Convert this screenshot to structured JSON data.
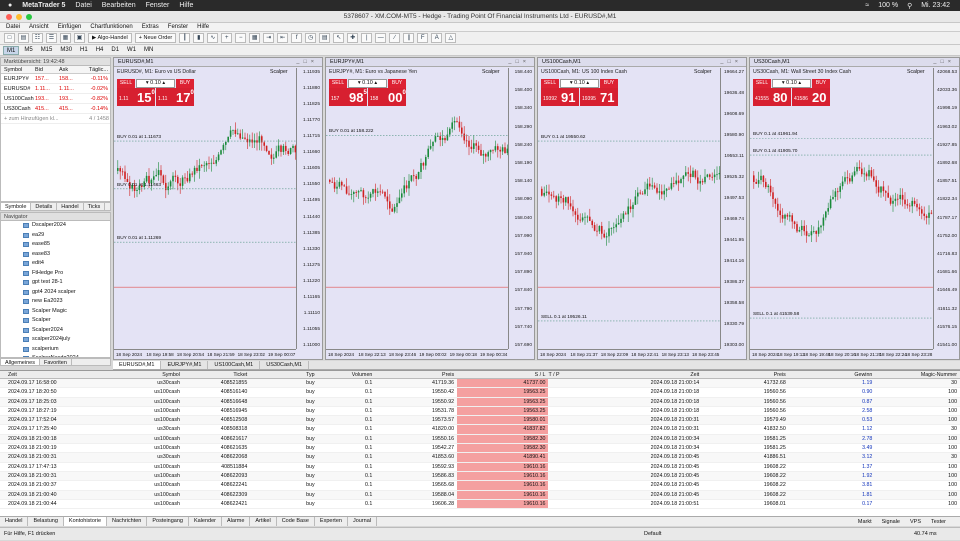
{
  "macbar": {
    "app": "MetaTrader 5",
    "menus": [
      "Datei",
      "Bearbeiten",
      "Fenster",
      "Hilfe"
    ],
    "battery": "100 %",
    "clock": "Mi. 23:42",
    "user": "jm"
  },
  "title": "5378607 - XM.COM-MT5 - Hedge - Trading Point Of Financial Instruments Ltd - EURUSD#,M1",
  "menu": [
    "Datei",
    "Ansicht",
    "Einfügen",
    "Chartfunktionen",
    "Extras",
    "Fenster",
    "Hilfe"
  ],
  "toolbar": {
    "algo": "Algo-Handel",
    "new_order": "Neue Order"
  },
  "timeframes": [
    "M1",
    "M5",
    "M15",
    "M30",
    "H1",
    "H4",
    "D1",
    "W1",
    "MN"
  ],
  "marketwatch": {
    "header": "Marktübersicht: 19:42:48",
    "cols": [
      "Symbol",
      "Bid",
      "Ask",
      "Täglic..."
    ],
    "rows": [
      {
        "s": "EURJPY#",
        "b": "157...",
        "a": "158...",
        "c": "-0.11%"
      },
      {
        "s": "EURUSD#",
        "b": "1.11...",
        "a": "1.11...",
        "c": "-0.02%"
      },
      {
        "s": "US100Cash",
        "b": "193...",
        "a": "193...",
        "c": "-0.82%"
      },
      {
        "s": "US30Cash",
        "b": "415...",
        "a": "415...",
        "c": "-0.14%"
      }
    ],
    "add": "+ zum Hinzufügen kl...",
    "count": "4 / 1458",
    "tabs": [
      "Symbole",
      "Details",
      "Handel",
      "Ticks"
    ]
  },
  "navigator": {
    "header": "Navigator",
    "items": [
      "Dscalper2024",
      "ea29",
      "ease85",
      "ease83",
      "edit4",
      "FtHedge Pro",
      "gpt test 28-1",
      "gpt4 2024 scalper",
      "new Ea2023",
      "Scalper Magic",
      "Scalper",
      "Scalper2024",
      "scalper2024july",
      "scalperium",
      "ScalperNasdq2024"
    ],
    "tabs": [
      "Allgemeines",
      "Favoriten"
    ]
  },
  "charts": [
    {
      "tab": "EURUSD#,M1",
      "sub": "EURUSD#, M1: Euro vs US Dollar",
      "lot": "0.10",
      "bid_pre": "1.11",
      "bid_big": "15",
      "bid_sup": "0",
      "ask_pre": "1.11",
      "ask_big": "17",
      "ask_sup": "0",
      "y": [
        "1.11935",
        "1.11880",
        "1.11825",
        "1.11770",
        "1.11715",
        "1.11660",
        "1.11605",
        "1.11550",
        "1.11495",
        "1.11440",
        "1.11385",
        "1.11330",
        "1.11275",
        "1.11220",
        "1.11165",
        "1.11110",
        "1.11055",
        "1.11000"
      ],
      "x": [
        "18 Sep 2024",
        "18 Sep 19:58",
        "18 Sep 20:54",
        "18 Sep 21:59",
        "18 Sep 23:02",
        "19 Sep 00:07"
      ],
      "orders": [
        {
          "t": "BUY 0.01 at 1.11673",
          "y": 0.26
        },
        {
          "t": "BUY 0.01 at 1.11463",
          "y": 0.43
        },
        {
          "t": "BUY 0.01 at 1.11269",
          "y": 0.62
        }
      ],
      "seed": 3
    },
    {
      "tab": "EURJPY#,M1",
      "sub": "EURJPY#, M1: Euro vs Japanese Yen",
      "lot": "0.10",
      "bid_pre": "157",
      "bid_big": "98",
      "bid_sup": "5",
      "ask_pre": "158",
      "ask_big": "00",
      "ask_sup": "0",
      "y": [
        "158.440",
        "158.400",
        "158.340",
        "158.290",
        "158.240",
        "158.190",
        "158.140",
        "158.090",
        "158.040",
        "157.990",
        "157.940",
        "157.890",
        "157.840",
        "157.790",
        "157.740",
        "157.690"
      ],
      "x": [
        "18 Sep 2024",
        "18 Sep 22:13",
        "18 Sep 23:46",
        "19 Sep 00:02",
        "19 Sep 00:18",
        "19 Sep 00:34"
      ],
      "orders": [
        {
          "t": "BUY 0.01 at 158.222",
          "y": 0.24
        }
      ],
      "seed": 7
    },
    {
      "tab": "US100Cash,M1",
      "sub": "US100Cash, M1: US 100 Index Cash",
      "lot": "0.10",
      "bid_pre": "19392",
      "bid_big": "91",
      "bid_sup": "",
      "ask_pre": "19395",
      "ask_big": "71",
      "ask_sup": "",
      "y": [
        "19664.27",
        "19636.48",
        "19608.69",
        "19580.90",
        "19553.11",
        "19525.32",
        "19497.53",
        "19469.74",
        "19441.95",
        "19414.16",
        "19386.37",
        "19358.58",
        "19330.79",
        "19303.00"
      ],
      "x": [
        "18 Sep 2024",
        "18 Sep 21:37",
        "18 Sep 22:09",
        "18 Sep 22:41",
        "18 Sep 23:13",
        "18 Sep 23:45"
      ],
      "orders": [
        {
          "t": "BUY 0.1 at 19550.62",
          "y": 0.26
        },
        {
          "t": "SELL 0.1 at 19526.11",
          "y": 0.9
        }
      ],
      "seed": 11
    },
    {
      "tab": "US30Cash,M1",
      "sub": "US30Cash, M1: Wall Street 30 Index Cash",
      "lot": "0.10",
      "bid_pre": "41555",
      "bid_big": "80",
      "bid_sup": "",
      "ask_pre": "41586",
      "ask_big": "20",
      "ask_sup": "",
      "y": [
        "42068.53",
        "42033.36",
        "41998.19",
        "41963.02",
        "41927.85",
        "41892.68",
        "41857.51",
        "41822.34",
        "41787.17",
        "41752.00",
        "41716.83",
        "41681.66",
        "41646.49",
        "41611.32",
        "41576.15",
        "41541.00"
      ],
      "x": [
        "18 Sep 2024",
        "18 Sep 19:12",
        "18 Sep 19:48",
        "18 Sep 20:16",
        "18 Sep 21:20",
        "18 Sep 22:24",
        "18 Sep 23:28"
      ],
      "orders": [
        {
          "t": "BUY 0.1 at 41961.94",
          "y": 0.25
        },
        {
          "t": "BUY 0.1 at 41905.70",
          "y": 0.31
        },
        {
          "t": "SELL 0.1 at 41539.58",
          "y": 0.89
        }
      ],
      "seed": 5
    }
  ],
  "scalper": "Scalper",
  "trade_labels": {
    "sell": "SELL",
    "buy": "BUY"
  },
  "history": {
    "cols": [
      "Zeit",
      "Symbol",
      "Ticket",
      "Typ",
      "Volumen",
      "Preis",
      "S / L",
      "T / P",
      "Zeit",
      "Preis",
      "Gewinn",
      "Magic-Nummer"
    ],
    "rows": [
      [
        "2024.09.17 16:58:00",
        "us30cash",
        "408521855",
        "buy",
        "0.1",
        "41719.36",
        "41737.00",
        "",
        "2024.09.18 21:00:14",
        "41732.68",
        "1.19",
        "30"
      ],
      [
        "2024.09.17 18:20:50",
        "us100cash",
        "408516140",
        "buy",
        "0.1",
        "19550.42",
        "19563.25",
        "",
        "2024.09.18 21:00:18",
        "19560.56",
        "0.90",
        "100"
      ],
      [
        "2024.09.17 18:25:03",
        "us100cash",
        "408516648",
        "buy",
        "0.1",
        "19550.92",
        "19563.25",
        "",
        "2024.09.18 21:00:18",
        "19560.56",
        "0.87",
        "100"
      ],
      [
        "2024.09.17 18:27:19",
        "us100cash",
        "408516945",
        "buy",
        "0.1",
        "19531.78",
        "19563.25",
        "",
        "2024.09.18 21:00:18",
        "19560.56",
        "2.58",
        "100"
      ],
      [
        "2024.09.17 17:52:04",
        "us100cash",
        "408512508",
        "buy",
        "0.1",
        "19573.57",
        "19580.01",
        "",
        "2024.09.18 21:00:31",
        "19579.49",
        "0.53",
        "100"
      ],
      [
        "2024.09.17 17:25:40",
        "us30cash",
        "408508318",
        "buy",
        "0.1",
        "41820.00",
        "41837.82",
        "",
        "2024.09.18 21:00:31",
        "41832.50",
        "1.12",
        "30"
      ],
      [
        "2024.09.18 21:00:18",
        "us100cash",
        "408621617",
        "buy",
        "0.1",
        "19550.16",
        "19582.30",
        "",
        "2024.09.18 21:00:34",
        "19581.25",
        "2.78",
        "100"
      ],
      [
        "2024.09.18 21:00:19",
        "us100cash",
        "408621635",
        "buy",
        "0.1",
        "19542.27",
        "19582.30",
        "",
        "2024.09.18 21:00:34",
        "19581.25",
        "3.49",
        "100"
      ],
      [
        "2024.09.18 21:00:31",
        "us30cash",
        "408622068",
        "buy",
        "0.1",
        "41853.60",
        "41890.41",
        "",
        "2024.09.18 21:00:45",
        "41886.51",
        "3.12",
        "30"
      ],
      [
        "2024.09.17 17:47:13",
        "us100cash",
        "408511884",
        "buy",
        "0.1",
        "19592.93",
        "19610.16",
        "",
        "2024.09.18 21:00:45",
        "19608.22",
        "1.37",
        "100"
      ],
      [
        "2024.09.18 21:00:31",
        "us100cash",
        "408622093",
        "buy",
        "0.1",
        "19586.83",
        "19610.16",
        "",
        "2024.09.18 21:00:45",
        "19608.22",
        "1.92",
        "100"
      ],
      [
        "2024.09.18 21:00:37",
        "us100cash",
        "408622241",
        "buy",
        "0.1",
        "19565.68",
        "19610.16",
        "",
        "2024.09.18 21:00:45",
        "19608.22",
        "3.81",
        "100"
      ],
      [
        "2024.09.18 21:00:40",
        "us100cash",
        "408622309",
        "buy",
        "0.1",
        "19588.04",
        "19610.16",
        "",
        "2024.09.18 21:00:45",
        "19608.22",
        "1.81",
        "100"
      ],
      [
        "2024.09.18 21:00:44",
        "us100cash",
        "408622421",
        "buy",
        "0.1",
        "19606.28",
        "19610.16",
        "",
        "2024.09.18 21:00:51",
        "19608.01",
        "0.17",
        "100"
      ]
    ]
  },
  "bottom_tabs": [
    "Handel",
    "Belastung",
    "Kontohistorie",
    "Nachrichten",
    "Postein­gang",
    "Kalender",
    "Alarme",
    "Artikel",
    "Code Base",
    "Experten",
    "Journal"
  ],
  "bottom_right": [
    "Markt",
    "Signale",
    "VPS",
    "Tester"
  ],
  "status": {
    "help": "Für Hilfe, F1 drücken",
    "profile": "Default",
    "ping": "40.74 ms"
  }
}
